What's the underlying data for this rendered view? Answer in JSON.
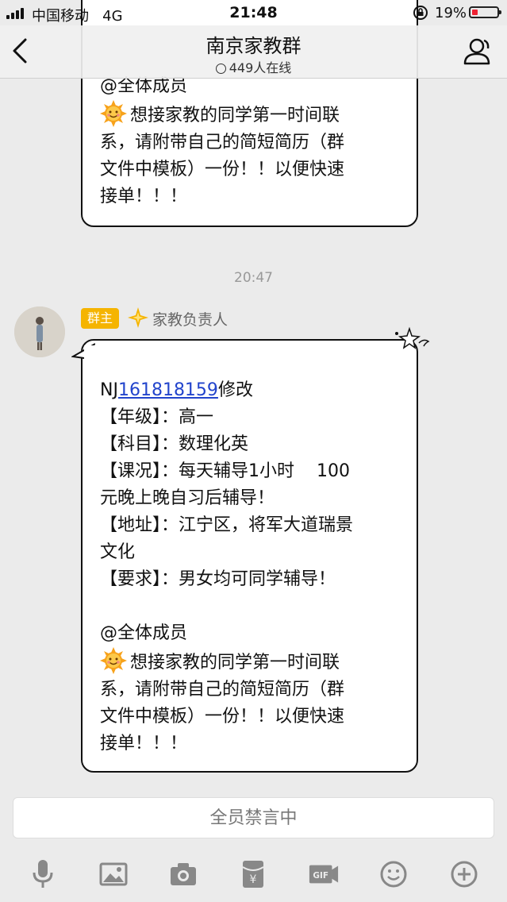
{
  "status_bar": {
    "carrier": "中国移动",
    "network": "4G",
    "time": "21:48",
    "battery": "19%",
    "battery_level": 0.19
  },
  "header": {
    "title": "南京家教群",
    "online_count": "449人在线"
  },
  "messages": [
    {
      "type": "bubble-partial",
      "lines": [
        "@全体成员",
        "想接家教的同学第一时间联",
        "系，请附带自己的简短简历（群",
        "文件中模板）一份！！以便快速",
        "接单！！！"
      ]
    }
  ],
  "timestamp": "20:47",
  "message2": {
    "badge": "群主",
    "sender": "家教负责人",
    "id_prefix": "NJ",
    "id_link": "161818159",
    "id_suffix": "修改",
    "lines": [
      "【年级】：高一",
      "【科目】：数理化英",
      "【课况】：每天辅导1小时    100",
      "元晚上晚自习后辅导！",
      "【地址】：江宁区，将军大道瑞景",
      "文化",
      "【要求】：男女均可同学辅导！",
      "",
      "@全体成员",
      "想接家教的同学第一时间联",
      "系，请附带自己的简短简历（群",
      "文件中模板）一份！！以便快速",
      "接单！！！"
    ]
  },
  "input": {
    "mute_text": "全员禁言中"
  },
  "toolbar": {
    "icons": [
      "microphone-icon",
      "image-icon",
      "camera-icon",
      "red-packet-icon",
      "gif-icon",
      "emoji-icon",
      "plus-icon"
    ],
    "gif_label": "GIF"
  },
  "colors": {
    "badge": "#f5b400",
    "link": "#2244cc",
    "background": "#ebebeb"
  }
}
